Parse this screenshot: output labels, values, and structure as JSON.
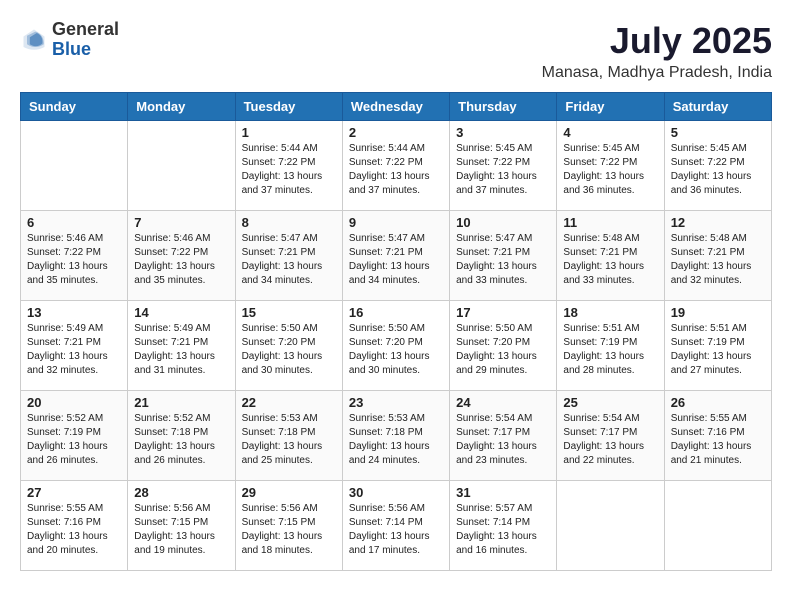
{
  "header": {
    "logo_general": "General",
    "logo_blue": "Blue",
    "month_title": "July 2025",
    "location": "Manasa, Madhya Pradesh, India"
  },
  "days_of_week": [
    "Sunday",
    "Monday",
    "Tuesday",
    "Wednesday",
    "Thursday",
    "Friday",
    "Saturday"
  ],
  "weeks": [
    [
      {
        "day": "",
        "info": ""
      },
      {
        "day": "",
        "info": ""
      },
      {
        "day": "1",
        "sunrise": "5:44 AM",
        "sunset": "7:22 PM",
        "daylight": "13 hours and 37 minutes."
      },
      {
        "day": "2",
        "sunrise": "5:44 AM",
        "sunset": "7:22 PM",
        "daylight": "13 hours and 37 minutes."
      },
      {
        "day": "3",
        "sunrise": "5:45 AM",
        "sunset": "7:22 PM",
        "daylight": "13 hours and 37 minutes."
      },
      {
        "day": "4",
        "sunrise": "5:45 AM",
        "sunset": "7:22 PM",
        "daylight": "13 hours and 36 minutes."
      },
      {
        "day": "5",
        "sunrise": "5:45 AM",
        "sunset": "7:22 PM",
        "daylight": "13 hours and 36 minutes."
      }
    ],
    [
      {
        "day": "6",
        "sunrise": "5:46 AM",
        "sunset": "7:22 PM",
        "daylight": "13 hours and 35 minutes."
      },
      {
        "day": "7",
        "sunrise": "5:46 AM",
        "sunset": "7:22 PM",
        "daylight": "13 hours and 35 minutes."
      },
      {
        "day": "8",
        "sunrise": "5:47 AM",
        "sunset": "7:21 PM",
        "daylight": "13 hours and 34 minutes."
      },
      {
        "day": "9",
        "sunrise": "5:47 AM",
        "sunset": "7:21 PM",
        "daylight": "13 hours and 34 minutes."
      },
      {
        "day": "10",
        "sunrise": "5:47 AM",
        "sunset": "7:21 PM",
        "daylight": "13 hours and 33 minutes."
      },
      {
        "day": "11",
        "sunrise": "5:48 AM",
        "sunset": "7:21 PM",
        "daylight": "13 hours and 33 minutes."
      },
      {
        "day": "12",
        "sunrise": "5:48 AM",
        "sunset": "7:21 PM",
        "daylight": "13 hours and 32 minutes."
      }
    ],
    [
      {
        "day": "13",
        "sunrise": "5:49 AM",
        "sunset": "7:21 PM",
        "daylight": "13 hours and 32 minutes."
      },
      {
        "day": "14",
        "sunrise": "5:49 AM",
        "sunset": "7:21 PM",
        "daylight": "13 hours and 31 minutes."
      },
      {
        "day": "15",
        "sunrise": "5:50 AM",
        "sunset": "7:20 PM",
        "daylight": "13 hours and 30 minutes."
      },
      {
        "day": "16",
        "sunrise": "5:50 AM",
        "sunset": "7:20 PM",
        "daylight": "13 hours and 30 minutes."
      },
      {
        "day": "17",
        "sunrise": "5:50 AM",
        "sunset": "7:20 PM",
        "daylight": "13 hours and 29 minutes."
      },
      {
        "day": "18",
        "sunrise": "5:51 AM",
        "sunset": "7:19 PM",
        "daylight": "13 hours and 28 minutes."
      },
      {
        "day": "19",
        "sunrise": "5:51 AM",
        "sunset": "7:19 PM",
        "daylight": "13 hours and 27 minutes."
      }
    ],
    [
      {
        "day": "20",
        "sunrise": "5:52 AM",
        "sunset": "7:19 PM",
        "daylight": "13 hours and 26 minutes."
      },
      {
        "day": "21",
        "sunrise": "5:52 AM",
        "sunset": "7:18 PM",
        "daylight": "13 hours and 26 minutes."
      },
      {
        "day": "22",
        "sunrise": "5:53 AM",
        "sunset": "7:18 PM",
        "daylight": "13 hours and 25 minutes."
      },
      {
        "day": "23",
        "sunrise": "5:53 AM",
        "sunset": "7:18 PM",
        "daylight": "13 hours and 24 minutes."
      },
      {
        "day": "24",
        "sunrise": "5:54 AM",
        "sunset": "7:17 PM",
        "daylight": "13 hours and 23 minutes."
      },
      {
        "day": "25",
        "sunrise": "5:54 AM",
        "sunset": "7:17 PM",
        "daylight": "13 hours and 22 minutes."
      },
      {
        "day": "26",
        "sunrise": "5:55 AM",
        "sunset": "7:16 PM",
        "daylight": "13 hours and 21 minutes."
      }
    ],
    [
      {
        "day": "27",
        "sunrise": "5:55 AM",
        "sunset": "7:16 PM",
        "daylight": "13 hours and 20 minutes."
      },
      {
        "day": "28",
        "sunrise": "5:56 AM",
        "sunset": "7:15 PM",
        "daylight": "13 hours and 19 minutes."
      },
      {
        "day": "29",
        "sunrise": "5:56 AM",
        "sunset": "7:15 PM",
        "daylight": "13 hours and 18 minutes."
      },
      {
        "day": "30",
        "sunrise": "5:56 AM",
        "sunset": "7:14 PM",
        "daylight": "13 hours and 17 minutes."
      },
      {
        "day": "31",
        "sunrise": "5:57 AM",
        "sunset": "7:14 PM",
        "daylight": "13 hours and 16 minutes."
      },
      {
        "day": "",
        "info": ""
      },
      {
        "day": "",
        "info": ""
      }
    ]
  ]
}
